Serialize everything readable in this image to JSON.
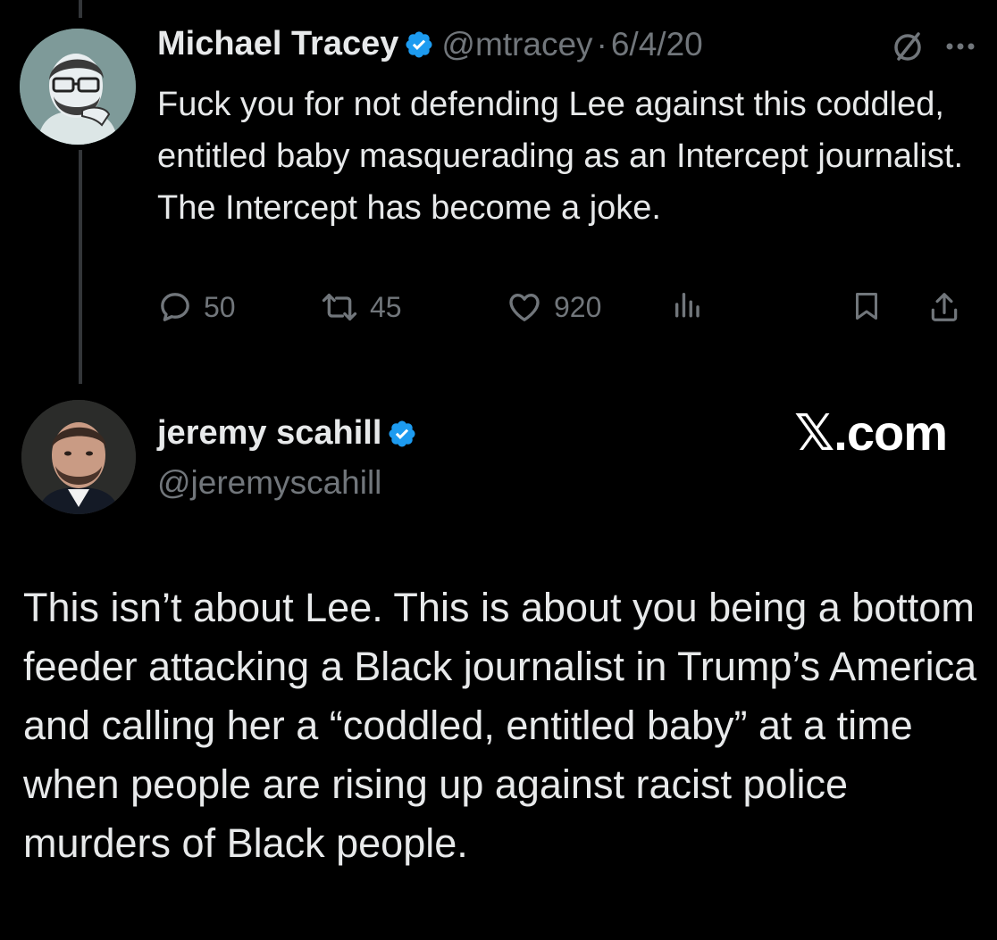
{
  "tweet": {
    "author_name": "Michael Tracey",
    "handle": "@mtracey",
    "separator": "·",
    "date": "6/4/20",
    "text": "Fuck you for not defending Lee against this coddled, entitled baby masquerading as an Intercept journalist. The Intercept has become a joke.",
    "icons": {
      "verified": "verified-badge-icon",
      "grok": "slashed-circle-icon",
      "more": "more-dots-icon"
    },
    "actions": {
      "replies": "50",
      "reposts": "45",
      "likes": "920",
      "reply_icon": "reply-icon",
      "repost_icon": "repost-icon",
      "like_icon": "heart-icon",
      "views_icon": "views-bar-icon",
      "bookmark_icon": "bookmark-icon",
      "share_icon": "share-icon"
    }
  },
  "reply": {
    "author_name": "jeremy scahill",
    "handle": "@jeremyscahill",
    "watermark": "𝕏.com",
    "text": "This isn’t about Lee. This is about you being a bottom feeder attacking a Black journalist in Trump’s America and calling her a “coddled, entitled baby” at a time when people are rising up against racist police murders of Black people."
  },
  "colors": {
    "background": "#000000",
    "text": "#e7e9ea",
    "muted": "#71767b",
    "verified": "#1d9bf0"
  }
}
